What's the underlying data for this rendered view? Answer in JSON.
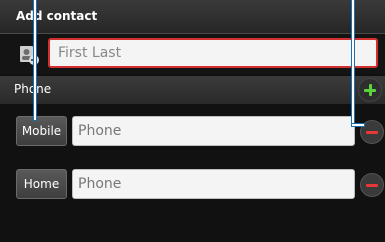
{
  "header": {
    "title": "Add contact"
  },
  "name_field": {
    "placeholder": "First Last",
    "value": ""
  },
  "phone_section": {
    "label": "Phone",
    "entries": [
      {
        "type_label": "Mobile",
        "placeholder": "Phone"
      },
      {
        "type_label": "Home",
        "placeholder": "Phone"
      }
    ]
  },
  "colors": {
    "active_field_border": "#d32f2f",
    "add_icon": "#5bd13b",
    "remove_icon": "#e53935",
    "callout_line": "#ffffff"
  },
  "icons": {
    "contact": "add-contact-icon",
    "add": "plus-icon",
    "remove": "minus-icon"
  }
}
